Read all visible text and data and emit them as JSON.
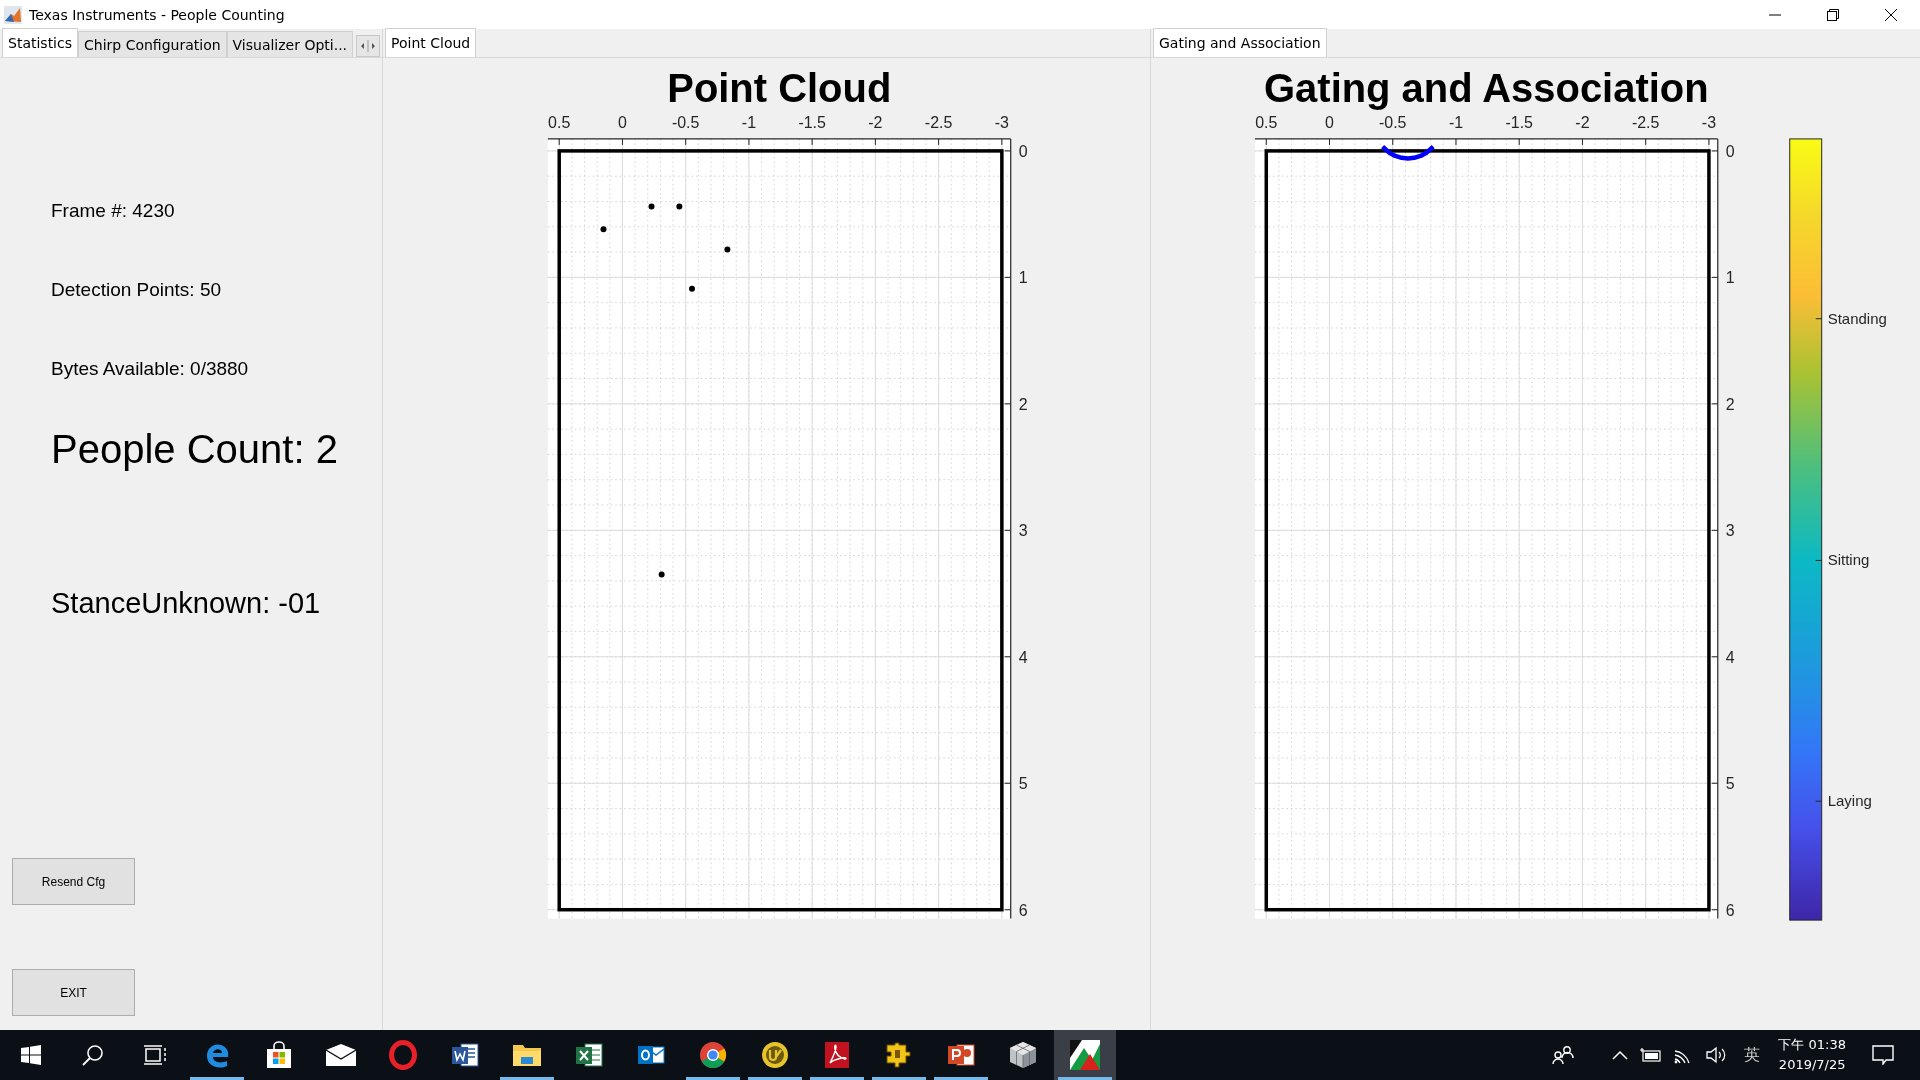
{
  "window": {
    "title": "Texas Instruments - People Counting"
  },
  "left_tabs": [
    {
      "label": "Statistics",
      "selected": true
    },
    {
      "label": "Chirp Configuration",
      "selected": false
    },
    {
      "label": "Visualizer Opti...",
      "selected": false
    }
  ],
  "statistics": [
    {
      "text": "Frame #: 4230",
      "kind": "normal"
    },
    {
      "text": "Detection Points: 50",
      "kind": "normal"
    },
    {
      "text": "Bytes Available: 0/3880",
      "kind": "normal"
    },
    {
      "text": "People Count: 2",
      "kind": "large"
    },
    {
      "text": "StanceUnknown: -01",
      "kind": "medium"
    }
  ],
  "buttons": [
    "Resend Cfg",
    "EXIT"
  ],
  "point_cloud_panel": {
    "tab": "Point Cloud",
    "chart_data": {
      "type": "scatter",
      "title": "Point Cloud",
      "x": [
        0.15,
        -0.23,
        -0.45,
        -0.83,
        -0.55,
        -0.31
      ],
      "series": [
        {
          "color": "#000000",
          "values": [
            0.62,
            0.44,
            0.44,
            0.78,
            1.09,
            3.35
          ]
        }
      ],
      "xlim": [
        0.59,
        -3.07
      ],
      "ylim": [
        6.07,
        -0.095
      ],
      "xticks": [
        0.5,
        0,
        -0.5,
        -1,
        -1.5,
        -2,
        -2.5,
        -3
      ],
      "yticks": [
        0,
        1,
        2,
        3,
        4,
        5,
        6
      ],
      "grid": true
    }
  },
  "gating_panel": {
    "tab": "Gating and Association",
    "chart_data": {
      "type": "line",
      "title": "Gating and Association",
      "x": [
        -0.42,
        -0.47,
        -0.52,
        -0.57,
        -0.62,
        -0.67,
        -0.72,
        -0.77,
        -0.82
      ],
      "series": [
        {
          "color": "#0000ff",
          "values": [
            -0.034,
            0.012,
            0.04,
            0.055,
            0.06,
            0.055,
            0.04,
            0.012,
            -0.034
          ]
        }
      ],
      "xlim": [
        0.59,
        -3.07
      ],
      "ylim": [
        6.07,
        -0.095
      ],
      "xticks": [
        0.5,
        0,
        -0.5,
        -1,
        -1.5,
        -2,
        -2.5,
        -3
      ],
      "yticks": [
        0,
        1,
        2,
        3,
        4,
        5,
        6
      ],
      "grid": true
    },
    "colorbar": {
      "labels": [
        "Standing",
        "Sitting",
        "Laying"
      ]
    }
  },
  "taskbar": {
    "apps": [
      {
        "kind": "start",
        "running": false,
        "selected": false
      },
      {
        "kind": "search",
        "running": false,
        "selected": false
      },
      {
        "kind": "taskview",
        "running": false,
        "selected": false
      },
      {
        "kind": "edge",
        "running": true,
        "selected": false
      },
      {
        "kind": "store",
        "running": false,
        "selected": false
      },
      {
        "kind": "mail",
        "running": false,
        "selected": false
      },
      {
        "kind": "opera",
        "running": false,
        "selected": false
      },
      {
        "kind": "word",
        "running": false,
        "selected": false
      },
      {
        "kind": "explorer",
        "running": true,
        "selected": false
      },
      {
        "kind": "excel",
        "running": false,
        "selected": false
      },
      {
        "kind": "outlook",
        "running": false,
        "selected": false
      },
      {
        "kind": "chrome",
        "running": true,
        "selected": false
      },
      {
        "kind": "ultraedit",
        "running": true,
        "selected": false
      },
      {
        "kind": "acrobat",
        "running": true,
        "selected": false
      },
      {
        "kind": "puzzle",
        "running": true,
        "selected": false
      },
      {
        "kind": "powerpoint",
        "running": true,
        "selected": false
      },
      {
        "kind": "cube",
        "running": false,
        "selected": false
      },
      {
        "kind": "visualizer",
        "running": true,
        "selected": true
      }
    ]
  },
  "tray": {
    "input_method": "英",
    "time": "下午 01:38",
    "date": "2019/7/25"
  }
}
